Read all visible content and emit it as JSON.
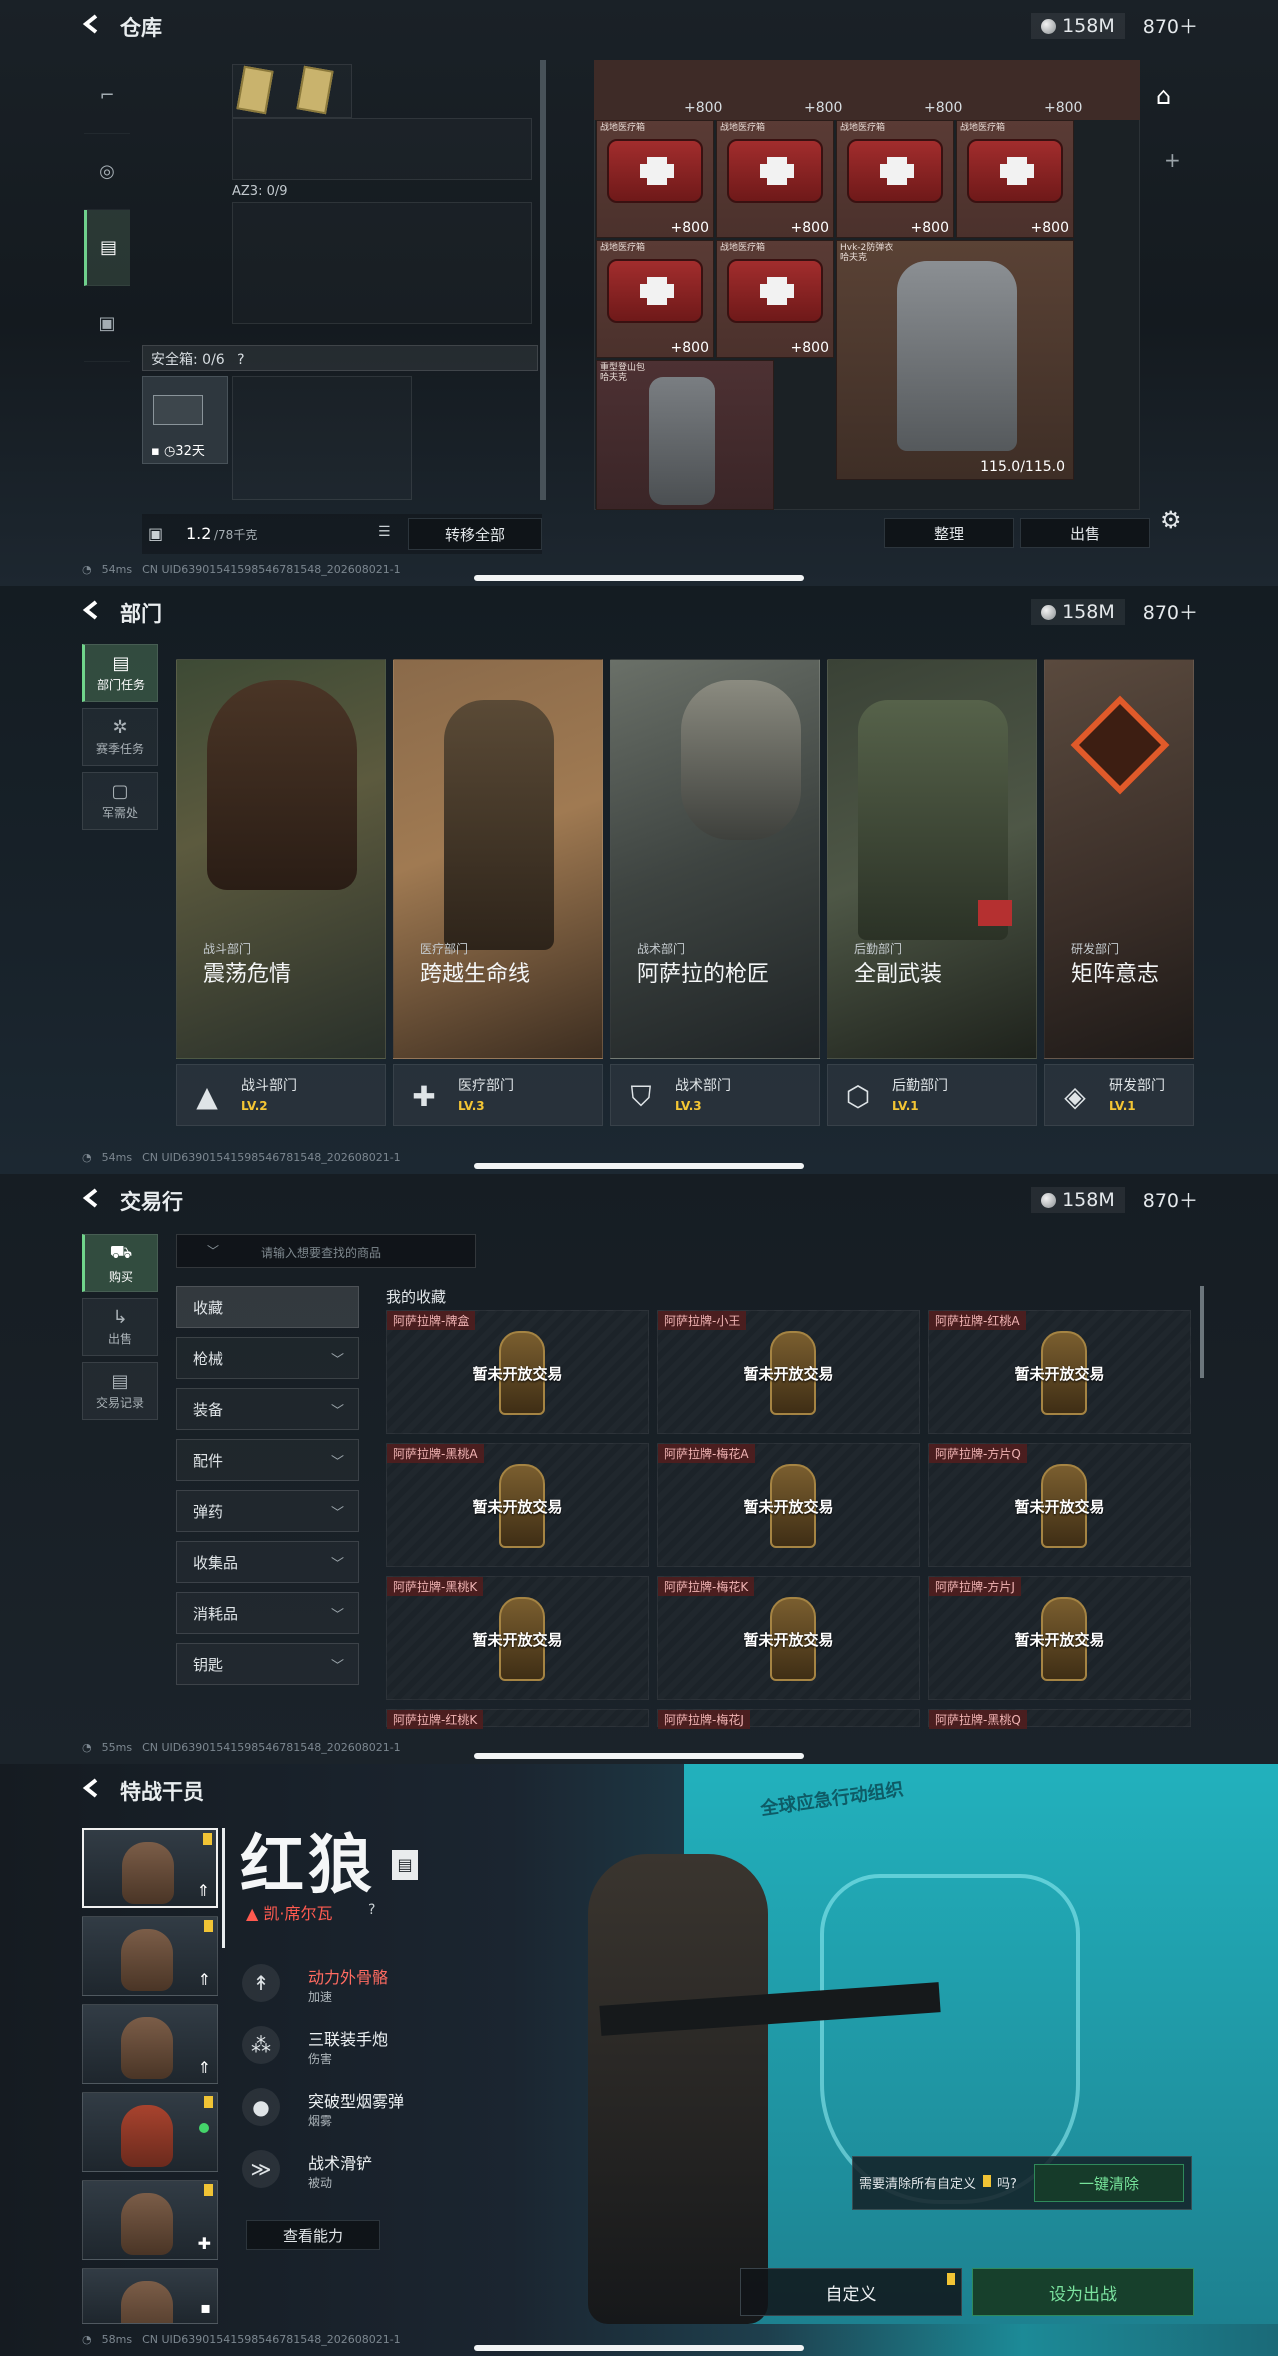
{
  "currency": {
    "coins": "158M",
    "premium": "870＋"
  },
  "status": {
    "ping1": "54ms",
    "ping2": "54ms",
    "ping3": "55ms",
    "ping4": "58ms",
    "uid": "CN UID639015415985467815​48_2026080​21-1"
  },
  "warehouse": {
    "title": "仓库",
    "az3": "AZ3: 0/9",
    "safebox_label": "安全箱: 0/6",
    "safebox_help": "?",
    "safebox_days": "32天",
    "capacity_value": "1.2",
    "capacity_unit": "/78千克",
    "transfer_all": "转移全部",
    "organize": "整理",
    "sell": "出售",
    "items": [
      {
        "name": "战地医疗箱",
        "qty": "800"
      },
      {
        "name": "战地医疗箱",
        "qty": "800"
      },
      {
        "name": "战地医疗箱",
        "qty": "800"
      },
      {
        "name": "战地医疗箱",
        "qty": "800"
      },
      {
        "name": "战地医疗箱",
        "qty": "800"
      },
      {
        "name": "战地医疗箱",
        "qty": "800"
      }
    ],
    "armor_name": "Hvk-2防弹衣\n哈夫克",
    "armor_durability": "115.0/115.0",
    "backpack_name": "重型登山包\n哈夫克"
  },
  "departments": {
    "title": "部门",
    "tabs": [
      "部门任务",
      "赛季任务",
      "军需处"
    ],
    "cards": [
      {
        "sub": "战斗部门",
        "title": "震荡危情",
        "dept": "战斗部门",
        "level": "LV.2",
        "color": "#5a6a4a"
      },
      {
        "sub": "医疗部门",
        "title": "跨越生命线",
        "dept": "医疗部门",
        "level": "LV.3",
        "color": "#7a5c3e"
      },
      {
        "sub": "战术部门",
        "title": "阿萨拉的枪匠",
        "dept": "战术部门",
        "level": "LV.3",
        "color": "#51585e"
      },
      {
        "sub": "后勤部门",
        "title": "全副武装",
        "dept": "后勤部门",
        "level": "LV.1",
        "color": "#4d5745"
      },
      {
        "sub": "研发部门",
        "title": "矩阵意志",
        "dept": "研发部门",
        "level": "LV.1",
        "color": "#5d4636"
      }
    ]
  },
  "market": {
    "title": "交易行",
    "search_placeholder": "请输入想要查找的商品",
    "tabs": [
      "购买",
      "出售",
      "交易记录"
    ],
    "categories": [
      "收藏",
      "枪械",
      "装备",
      "配件",
      "弹药",
      "收集品",
      "消耗品",
      "钥匙"
    ],
    "section_title": "我的收藏",
    "not_open": "暂未开放交易",
    "cards": [
      "阿萨拉牌-牌盒",
      "阿萨拉牌-小王",
      "阿萨拉牌-红桃A",
      "阿萨拉牌-黑桃A",
      "阿萨拉牌-梅花A",
      "阿萨拉牌-方片Q",
      "阿萨拉牌-黑桃K",
      "阿萨拉牌-梅花K",
      "阿萨拉牌-方片J",
      "阿萨拉牌-红桃K",
      "阿萨拉牌-梅花J",
      "阿萨拉牌-黑桃Q"
    ]
  },
  "operators": {
    "title": "特战干员",
    "name": "红狼",
    "codename": "凯·席尔瓦",
    "help": "?",
    "skills": [
      {
        "name": "动力外骨骼",
        "type": "加速"
      },
      {
        "name": "三联装手炮",
        "type": "伤害"
      },
      {
        "name": "突破型烟雾弹",
        "type": "烟雾"
      },
      {
        "name": "战术滑铲",
        "type": "被动"
      }
    ],
    "view_ability": "查看能力",
    "clear_prompt": "需要清除所有自定义",
    "clear_suffix": "吗?",
    "clear_button": "一键清除",
    "customize": "自定义",
    "set_deploy": "设为出战",
    "banner_text": "全球应急行动组织"
  }
}
